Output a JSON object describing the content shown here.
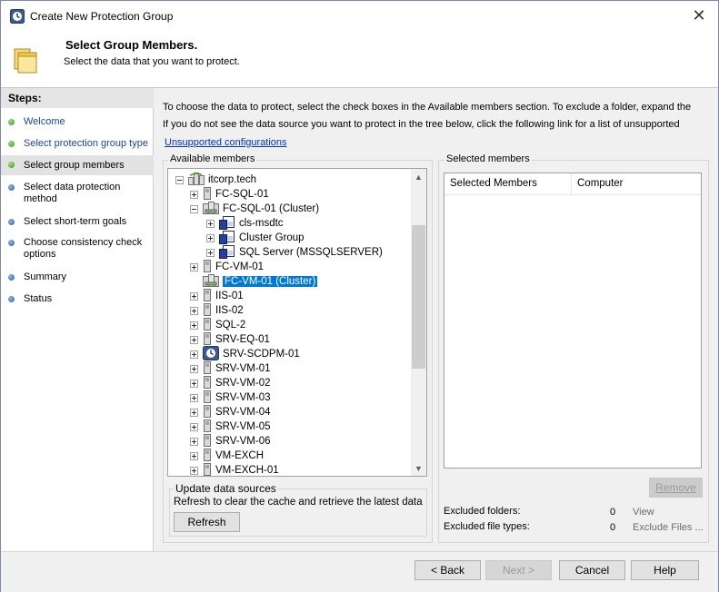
{
  "window": {
    "title": "Create New Protection Group",
    "close_glyph": "✕"
  },
  "header": {
    "title": "Select Group Members.",
    "subtitle": "Select the data that you want to protect."
  },
  "steps": {
    "title": "Steps:",
    "items": [
      {
        "label": "Welcome",
        "status": "link"
      },
      {
        "label": "Select protection group type",
        "status": "link"
      },
      {
        "label": "Select group members",
        "status": "current"
      },
      {
        "label": "Select data protection method",
        "status": "pending"
      },
      {
        "label": "Select short-term goals",
        "status": "pending"
      },
      {
        "label": "Choose consistency check options",
        "status": "pending"
      },
      {
        "label": "Summary",
        "status": "pending"
      },
      {
        "label": "Status",
        "status": "pending"
      }
    ]
  },
  "instructions": {
    "line1": "To choose the data to protect, select the check boxes in the Available members section. To exclude a folder, expand the",
    "line2": "If you do not see the data source you want to protect in the tree below, click the following link for a list of unsupported",
    "link": "Unsupported configurations"
  },
  "available_members": {
    "label": "Available members",
    "tree": [
      {
        "label": "itcorp.tech",
        "icon": "domain-icon",
        "level": 0,
        "expander": "minus"
      },
      {
        "label": "FC-SQL-01",
        "icon": "server-icon",
        "level": 1,
        "expander": "plus"
      },
      {
        "label": "FC-SQL-01 (Cluster)",
        "icon": "cluster-icon",
        "level": 1,
        "expander": "minus"
      },
      {
        "label": "cls-msdtc",
        "icon": "resource-group-icon",
        "level": 2,
        "expander": "plus"
      },
      {
        "label": "Cluster Group",
        "icon": "resource-group-icon",
        "level": 2,
        "expander": "plus"
      },
      {
        "label": "SQL Server (MSSQLSERVER)",
        "icon": "resource-group-icon",
        "level": 2,
        "expander": "plus"
      },
      {
        "label": "FC-VM-01",
        "icon": "server-icon",
        "level": 1,
        "expander": "plus"
      },
      {
        "label": "FC-VM-01 (Cluster)",
        "icon": "cluster-icon",
        "level": 1,
        "expander": "none",
        "selected": true
      },
      {
        "label": "IIS-01",
        "icon": "server-icon",
        "level": 1,
        "expander": "plus"
      },
      {
        "label": "IIS-02",
        "icon": "server-icon",
        "level": 1,
        "expander": "plus"
      },
      {
        "label": "SQL-2",
        "icon": "server-icon",
        "level": 1,
        "expander": "plus"
      },
      {
        "label": "SRV-EQ-01",
        "icon": "server-icon",
        "level": 1,
        "expander": "plus"
      },
      {
        "label": "SRV-SCDPM-01",
        "icon": "dpm-server-icon",
        "level": 1,
        "expander": "plus"
      },
      {
        "label": "SRV-VM-01",
        "icon": "server-icon",
        "level": 1,
        "expander": "plus"
      },
      {
        "label": "SRV-VM-02",
        "icon": "server-icon",
        "level": 1,
        "expander": "plus"
      },
      {
        "label": "SRV-VM-03",
        "icon": "server-icon",
        "level": 1,
        "expander": "plus"
      },
      {
        "label": "SRV-VM-04",
        "icon": "server-icon",
        "level": 1,
        "expander": "plus"
      },
      {
        "label": "SRV-VM-05",
        "icon": "server-icon",
        "level": 1,
        "expander": "plus"
      },
      {
        "label": "SRV-VM-06",
        "icon": "server-icon",
        "level": 1,
        "expander": "plus"
      },
      {
        "label": "VM-EXCH",
        "icon": "server-icon",
        "level": 1,
        "expander": "plus"
      },
      {
        "label": "VM-EXCH-01",
        "icon": "server-icon",
        "level": 1,
        "expander": "plus"
      }
    ]
  },
  "selected_members": {
    "label": "Selected members",
    "columns": [
      "Selected Members",
      "Computer"
    ],
    "remove_label": "Remove",
    "excluded_folders_label": "Excluded folders:",
    "excluded_folders_count": "0",
    "excluded_folders_action": "View",
    "excluded_types_label": "Excluded file types:",
    "excluded_types_count": "0",
    "excluded_types_action": "Exclude Files ..."
  },
  "update_sources": {
    "label": "Update data sources",
    "description": "Refresh to clear the cache and retrieve the latest data",
    "refresh_label": "Refresh"
  },
  "footer": {
    "back_label": "< Back",
    "next_label": "Next >",
    "cancel_label": "Cancel",
    "help_label": "Help"
  },
  "colors": {
    "accent": "#0078d7",
    "link": "#1a43b3",
    "step_done": "#2e9b1f",
    "step_pending": "#2e5fa8"
  }
}
